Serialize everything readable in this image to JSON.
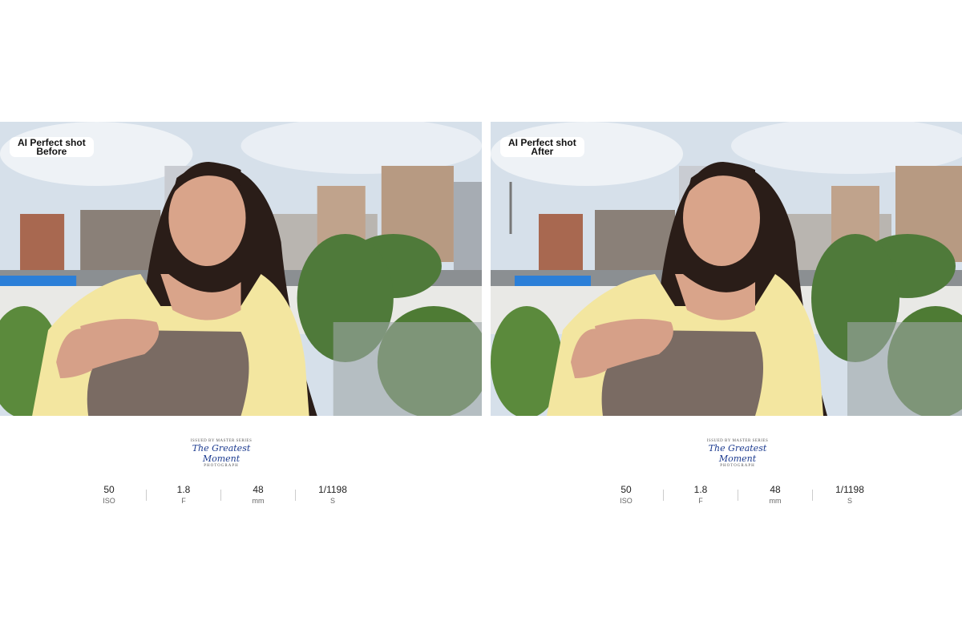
{
  "panels": [
    {
      "label_line1": "AI Perfect shot",
      "label_line2": "Before",
      "signature": {
        "top": "ISSUED BY MASTER SERIES",
        "main": "The Greatest Moment",
        "bottom": "PHOTOGRAPH"
      },
      "stats": [
        {
          "value": "50",
          "unit": "ISO"
        },
        {
          "value": "1.8",
          "unit": "F"
        },
        {
          "value": "48",
          "unit": "mm"
        },
        {
          "value": "1/1198",
          "unit": "S"
        }
      ]
    },
    {
      "label_line1": "AI Perfect shot",
      "label_line2": "After",
      "signature": {
        "top": "ISSUED BY MASTER SERIES",
        "main": "The Greatest Moment",
        "bottom": "PHOTOGRAPH"
      },
      "stats": [
        {
          "value": "50",
          "unit": "ISO"
        },
        {
          "value": "1.8",
          "unit": "F"
        },
        {
          "value": "48",
          "unit": "mm"
        },
        {
          "value": "1/1198",
          "unit": "S"
        }
      ]
    }
  ],
  "colors": {
    "sky": "#d4dfea",
    "shirt": "#f3e6a0",
    "top": "#7a6b63",
    "hair": "#2a1d18",
    "skin": "#d9a48a",
    "tree": "#4f7a3a"
  },
  "scene": "woman in yellow shirt with city skyline and trees behind"
}
